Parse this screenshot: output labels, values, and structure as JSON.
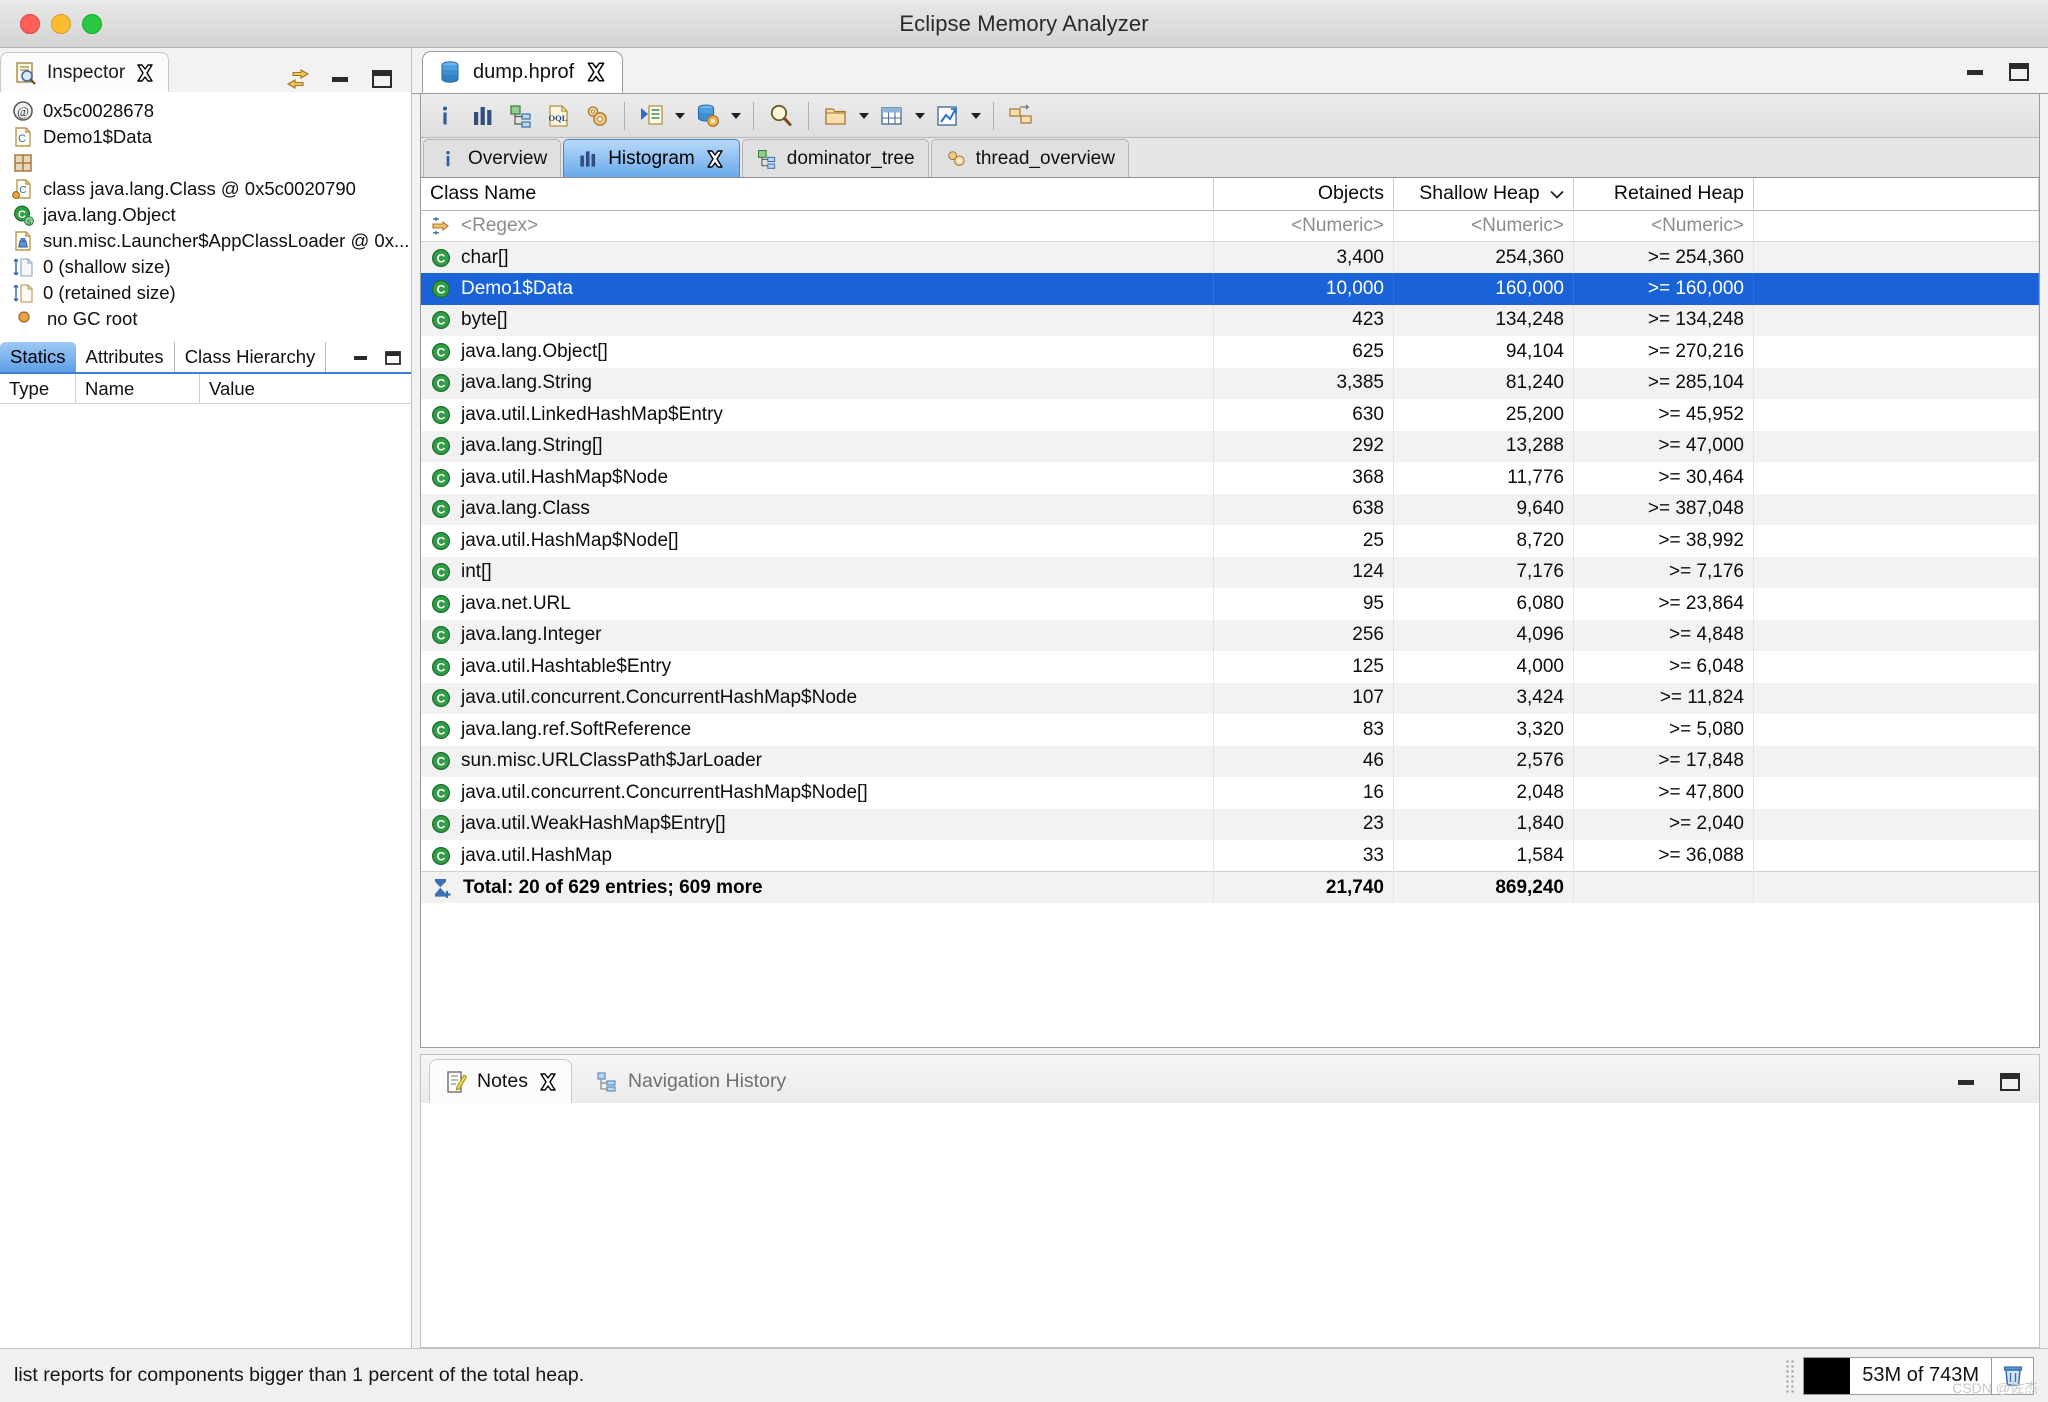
{
  "window": {
    "title": "Eclipse Memory Analyzer",
    "traffic_lights": [
      "close-button",
      "minimize-button",
      "maximize-button"
    ]
  },
  "inspector": {
    "tab_label": "Inspector",
    "tab_icon": "inspector-icon",
    "close_icon": "close-icon",
    "view_menu_icon": "link-with-editor-icon",
    "minimize_icon": "minimize-icon",
    "maximize_icon": "maximize-icon",
    "rows": [
      {
        "icon": "at-address-icon",
        "label": "0x5c0028678"
      },
      {
        "icon": "class-file-icon",
        "label": "Demo1$Data"
      },
      {
        "icon": "grid-icon",
        "label": ""
      },
      {
        "icon": "class-object-icon",
        "label": "class java.lang.Class @ 0x5c0020790"
      },
      {
        "icon": "superclass-icon",
        "label": "java.lang.Object"
      },
      {
        "icon": "classloader-icon",
        "label": "sun.misc.Launcher$AppClassLoader @ 0x..."
      },
      {
        "icon": "shallow-size-icon",
        "label": "0 (shallow size)"
      },
      {
        "icon": "retained-size-icon",
        "label": "0 (retained size)"
      },
      {
        "icon": "gc-root-icon",
        "label": "no GC root"
      }
    ],
    "tabs": [
      {
        "label": "Statics",
        "active": true
      },
      {
        "label": "Attributes",
        "active": false
      },
      {
        "label": "Class Hierarchy",
        "active": false
      }
    ],
    "property_columns": [
      "Type",
      "Name",
      "Value"
    ],
    "property_rows": []
  },
  "editor": {
    "tab_label": "dump.hprof",
    "tab_icon": "heap-dump-icon",
    "close_icon": "close-icon",
    "minimize_icon": "minimize-icon",
    "maximize_icon": "maximize-icon",
    "toolbar": [
      {
        "name": "overview-info-button",
        "icon": "info-icon",
        "caret": false
      },
      {
        "name": "histogram-button",
        "icon": "histogram-icon",
        "caret": false
      },
      {
        "name": "dominator-tree-button",
        "icon": "dominator-tree-icon",
        "caret": false
      },
      {
        "name": "oql-button",
        "icon": "oql-icon",
        "caret": false
      },
      {
        "name": "calculate-retained-size-button",
        "icon": "gears-icon",
        "caret": false
      },
      {
        "sep": true
      },
      {
        "name": "run-query-button",
        "icon": "run-expert-query-icon",
        "caret": true
      },
      {
        "name": "open-heap-dump-query-button",
        "icon": "heap-query-icon",
        "caret": true
      },
      {
        "sep": true
      },
      {
        "name": "find-button",
        "icon": "search-icon",
        "caret": false
      },
      {
        "sep": true
      },
      {
        "name": "group-by-button",
        "icon": "group-by-icon",
        "caret": true
      },
      {
        "name": "export-table-button",
        "icon": "export-table-icon",
        "caret": true
      },
      {
        "name": "export-chart-button",
        "icon": "export-chart-icon",
        "caret": true
      },
      {
        "sep": true
      },
      {
        "name": "compare-snapshot-button",
        "icon": "compare-icon",
        "caret": false
      }
    ],
    "view_tabs": [
      {
        "label": "Overview",
        "icon": "info-icon",
        "active": false,
        "closable": false
      },
      {
        "label": "Histogram",
        "icon": "histogram-icon",
        "active": true,
        "closable": true
      },
      {
        "label": "dominator_tree",
        "icon": "dominator-tree-icon",
        "active": false,
        "closable": false
      },
      {
        "label": "thread_overview",
        "icon": "thread-overview-icon",
        "active": false,
        "closable": false
      }
    ]
  },
  "histogram": {
    "columns": [
      "Class Name",
      "Objects",
      "Shallow Heap",
      "Retained Heap"
    ],
    "sorted_column": "Shallow Heap",
    "sort_direction": "descending",
    "sort_icon": "chevron-down-icon",
    "filter_row": {
      "icon": "regex-filter-icon",
      "class_name": "<Regex>",
      "objects": "<Numeric>",
      "shallow": "<Numeric>",
      "retained": "<Numeric>"
    },
    "rows": [
      {
        "icon": "class-icon",
        "name": "char[]",
        "objects": "3,400",
        "shallow": "254,360",
        "retained": ">= 254,360",
        "selected": false
      },
      {
        "icon": "class-icon",
        "name": "Demo1$Data",
        "objects": "10,000",
        "shallow": "160,000",
        "retained": ">= 160,000",
        "selected": true
      },
      {
        "icon": "class-icon",
        "name": "byte[]",
        "objects": "423",
        "shallow": "134,248",
        "retained": ">= 134,248",
        "selected": false
      },
      {
        "icon": "class-icon",
        "name": "java.lang.Object[]",
        "objects": "625",
        "shallow": "94,104",
        "retained": ">= 270,216",
        "selected": false
      },
      {
        "icon": "class-icon",
        "name": "java.lang.String",
        "objects": "3,385",
        "shallow": "81,240",
        "retained": ">= 285,104",
        "selected": false
      },
      {
        "icon": "class-icon",
        "name": "java.util.LinkedHashMap$Entry",
        "objects": "630",
        "shallow": "25,200",
        "retained": ">= 45,952",
        "selected": false
      },
      {
        "icon": "class-icon",
        "name": "java.lang.String[]",
        "objects": "292",
        "shallow": "13,288",
        "retained": ">= 47,000",
        "selected": false
      },
      {
        "icon": "class-icon",
        "name": "java.util.HashMap$Node",
        "objects": "368",
        "shallow": "11,776",
        "retained": ">= 30,464",
        "selected": false
      },
      {
        "icon": "class-icon",
        "name": "java.lang.Class",
        "objects": "638",
        "shallow": "9,640",
        "retained": ">= 387,048",
        "selected": false
      },
      {
        "icon": "class-icon",
        "name": "java.util.HashMap$Node[]",
        "objects": "25",
        "shallow": "8,720",
        "retained": ">= 38,992",
        "selected": false
      },
      {
        "icon": "class-icon",
        "name": "int[]",
        "objects": "124",
        "shallow": "7,176",
        "retained": ">= 7,176",
        "selected": false
      },
      {
        "icon": "class-icon",
        "name": "java.net.URL",
        "objects": "95",
        "shallow": "6,080",
        "retained": ">= 23,864",
        "selected": false
      },
      {
        "icon": "class-icon",
        "name": "java.lang.Integer",
        "objects": "256",
        "shallow": "4,096",
        "retained": ">= 4,848",
        "selected": false
      },
      {
        "icon": "class-icon",
        "name": "java.util.Hashtable$Entry",
        "objects": "125",
        "shallow": "4,000",
        "retained": ">= 6,048",
        "selected": false
      },
      {
        "icon": "class-icon",
        "name": "java.util.concurrent.ConcurrentHashMap$Node",
        "objects": "107",
        "shallow": "3,424",
        "retained": ">= 11,824",
        "selected": false
      },
      {
        "icon": "class-icon",
        "name": "java.lang.ref.SoftReference",
        "objects": "83",
        "shallow": "3,320",
        "retained": ">= 5,080",
        "selected": false
      },
      {
        "icon": "class-icon",
        "name": "sun.misc.URLClassPath$JarLoader",
        "objects": "46",
        "shallow": "2,576",
        "retained": ">= 17,848",
        "selected": false
      },
      {
        "icon": "class-icon",
        "name": "java.util.concurrent.ConcurrentHashMap$Node[]",
        "objects": "16",
        "shallow": "2,048",
        "retained": ">= 47,800",
        "selected": false
      },
      {
        "icon": "class-icon",
        "name": "java.util.WeakHashMap$Entry[]",
        "objects": "23",
        "shallow": "1,840",
        "retained": ">= 2,040",
        "selected": false
      },
      {
        "icon": "class-icon",
        "name": "java.util.HashMap",
        "objects": "33",
        "shallow": "1,584",
        "retained": ">= 36,088",
        "selected": false
      }
    ],
    "total_row": {
      "icon": "sum-icon",
      "label": "Total: 20 of 629 entries; 609 more",
      "objects": "21,740",
      "shallow": "869,240",
      "retained": ""
    }
  },
  "bottom_panel": {
    "tabs": [
      {
        "label": "Notes",
        "icon": "notes-icon",
        "active": true,
        "closable": true
      },
      {
        "label": "Navigation History",
        "icon": "navigation-history-icon",
        "active": false,
        "closable": false
      }
    ],
    "minimize_icon": "minimize-icon",
    "maximize_icon": "maximize-icon",
    "content": ""
  },
  "status_bar": {
    "message": "list reports for components bigger than 1 percent of the total heap.",
    "heap_usage": "53M of 743M",
    "heap_trash_icon": "trash-icon",
    "grip_icon": "resize-grip-icon",
    "watermark": "CSDN @佐杰"
  },
  "colors": {
    "selection_blue": "#1a62d8",
    "active_tab_blue": "#6aa9ec",
    "class_icon_green": "#2f9e44",
    "title_bar": "#d4d4d4"
  }
}
